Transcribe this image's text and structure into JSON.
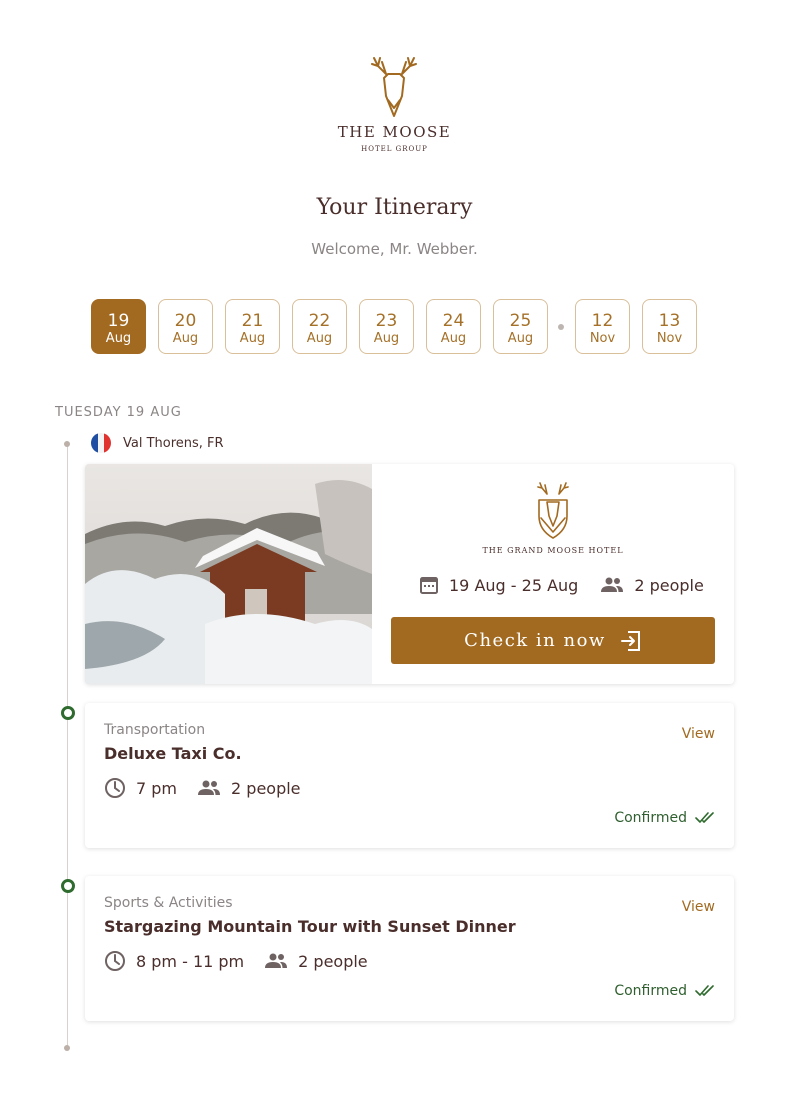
{
  "brand": {
    "name": "THE MOOSE",
    "sub": "HOTEL GROUP",
    "accent": "#a26a21"
  },
  "header": {
    "title": "Your Itinerary",
    "welcome": "Welcome, Mr. Webber."
  },
  "dates": [
    {
      "day": "19",
      "month": "Aug",
      "active": true
    },
    {
      "day": "20",
      "month": "Aug"
    },
    {
      "day": "21",
      "month": "Aug"
    },
    {
      "day": "22",
      "month": "Aug"
    },
    {
      "day": "23",
      "month": "Aug"
    },
    {
      "day": "24",
      "month": "Aug"
    },
    {
      "day": "25",
      "month": "Aug"
    },
    {
      "day": "12",
      "month": "Nov"
    },
    {
      "day": "13",
      "month": "Nov"
    }
  ],
  "day_heading": "TUESDAY 19 AUG",
  "location": "Val Thorens, FR",
  "hotel": {
    "name": "THE GRAND MOOSE HOTEL",
    "dates": "19 Aug - 25 Aug",
    "people": "2 people",
    "checkin_label": "Check in now"
  },
  "items": [
    {
      "category": "Transportation",
      "title": "Deluxe Taxi Co.",
      "time": "7 pm",
      "people": "2 people",
      "view_label": "View",
      "status": "Confirmed"
    },
    {
      "category": "Sports & Activities",
      "title": "Stargazing Mountain Tour with Sunset Dinner",
      "time": "8 pm - 11 pm",
      "people": "2 people",
      "view_label": "View",
      "status": "Confirmed"
    }
  ],
  "colors": {
    "status_green": "#2f6b2f",
    "text_dark": "#4a2e2b",
    "muted": "#8b8585"
  }
}
